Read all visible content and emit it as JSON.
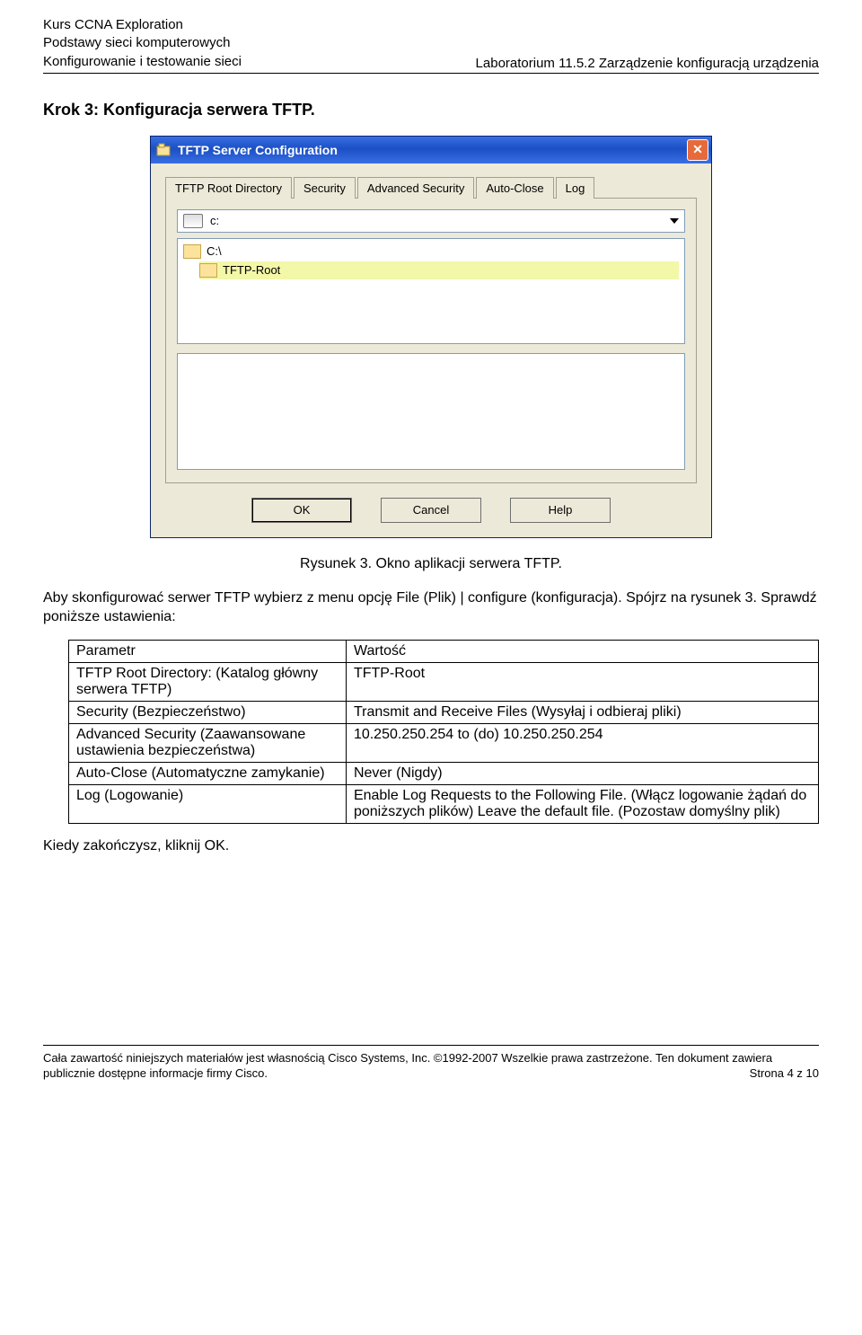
{
  "header": {
    "left1": "Kurs CCNA Exploration",
    "left2": "Podstawy sieci komputerowych",
    "left3": "Konfigurowanie i testowanie sieci",
    "right": "Laboratorium 11.5.2 Zarządzenie konfiguracją urządzenia"
  },
  "step_title": "Krok 3: Konfiguracja serwera TFTP.",
  "window": {
    "title": "TFTP Server Configuration",
    "tabs": {
      "root": "TFTP Root Directory",
      "security": "Security",
      "advanced": "Advanced Security",
      "autoclose": "Auto-Close",
      "log": "Log"
    },
    "drive": "c:",
    "tree": {
      "row1": "C:\\",
      "row2": "TFTP-Root"
    },
    "buttons": {
      "ok": "OK",
      "cancel": "Cancel",
      "help": "Help"
    }
  },
  "caption": "Rysunek 3. Okno aplikacji serwera TFTP.",
  "para1": "Aby skonfigurować serwer TFTP wybierz z menu opcję File (Plik) | configure (konfiguracja). Spójrz na rysunek 3. Sprawdź poniższe ustawienia:",
  "table": {
    "header": {
      "param": "Parametr",
      "value": "Wartość"
    },
    "rows": [
      {
        "param": "TFTP Root Directory: (Katalog główny serwera TFTP)",
        "value": "TFTP-Root"
      },
      {
        "param": "Security (Bezpieczeństwo)",
        "value": "Transmit and Receive Files (Wysyłaj i odbieraj pliki)"
      },
      {
        "param": "Advanced Security (Zaawansowane ustawienia bezpieczeństwa)",
        "value": "10.250.250.254 to (do) 10.250.250.254"
      },
      {
        "param": "Auto-Close (Automatyczne zamykanie)",
        "value": "Never (Nigdy)"
      },
      {
        "param": "Log (Logowanie)",
        "value": "Enable Log Requests to the Following File. (Włącz logowanie żądań do poniższych plików) Leave the default file. (Pozostaw domyślny plik)"
      }
    ]
  },
  "para2": "Kiedy zakończysz, kliknij OK.",
  "footer": {
    "line1": "Cała zawartość niniejszych materiałów jest własnością Cisco Systems, Inc. ©1992-2007 Wszelkie prawa zastrzeżone. Ten dokument zawiera",
    "line2_left": "publicznie dostępne informacje firmy Cisco.",
    "line2_right": "Strona 4 z 10"
  }
}
